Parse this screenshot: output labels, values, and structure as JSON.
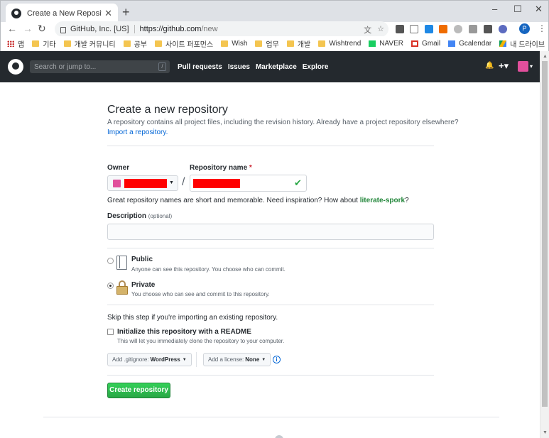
{
  "browser": {
    "tab_title": "Create a New Repository",
    "tab_close": "✕",
    "new_tab": "+",
    "window_controls": [
      "–",
      "☐",
      "✕"
    ],
    "nav": {
      "back": "←",
      "forward": "→",
      "reload": "↻"
    },
    "site_identity": "GitHub, Inc. [US]",
    "url_host": "https://github.com",
    "url_path": "/new",
    "omnibox_icons": [
      "translate-icon",
      "star-icon"
    ],
    "profile_letter": "P",
    "menu": "⋮"
  },
  "bookmarks": [
    {
      "label": "앱",
      "icon": "apps-icon"
    },
    {
      "label": "기타",
      "icon": "folder-icon"
    },
    {
      "label": "개발 커뮤니티",
      "icon": "folder-icon"
    },
    {
      "label": "공부",
      "icon": "folder-icon"
    },
    {
      "label": "사이트 퍼포먼스",
      "icon": "folder-icon"
    },
    {
      "label": "Wish",
      "icon": "folder-icon"
    },
    {
      "label": "업무",
      "icon": "folder-icon"
    },
    {
      "label": "개발",
      "icon": "folder-icon"
    },
    {
      "label": "Wishtrend",
      "icon": "folder-icon"
    },
    {
      "label": "NAVER",
      "icon": "naver-icon"
    },
    {
      "label": "Gmail",
      "icon": "gmail-icon"
    },
    {
      "label": "Gcalendar",
      "icon": "calendar-icon"
    },
    {
      "label": "내 드라이브",
      "icon": "drive-icon"
    }
  ],
  "github_header": {
    "search_placeholder": "Search or jump to...",
    "search_shortcut": "/",
    "nav": [
      "Pull requests",
      "Issues",
      "Marketplace",
      "Explore"
    ],
    "bell": "🔔",
    "plus": "+▾",
    "avatar_caret": "▾"
  },
  "page": {
    "title": "Create a new repository",
    "subtitle": "A repository contains all project files, including the revision history. Already have a project repository elsewhere?",
    "import_link": "Import a repository.",
    "owner_label": "Owner",
    "repo_name_label": "Repository name",
    "required_mark": "*",
    "separator": "/",
    "check": "✔",
    "hint_prefix": "Great repository names are short and memorable. Need inspiration? How about",
    "hint_suggestion": "literate-spork",
    "hint_suffix": "?",
    "description_label": "Description",
    "description_optional": "(optional)",
    "public_title": "Public",
    "public_desc": "Anyone can see this repository. You choose who can commit.",
    "private_title": "Private",
    "private_desc": "You choose who can see and commit to this repository.",
    "visibility_selected": "Private",
    "skip_text": "Skip this step if you're importing an existing repository.",
    "init_title": "Initialize this repository with a README",
    "init_desc": "This will let you immediately clone the repository to your computer.",
    "init_checked": false,
    "gitignore_prefix": "Add .gitignore:",
    "gitignore_value": "WordPress",
    "license_prefix": "Add a license:",
    "license_value": "None",
    "info": "i",
    "create_button": "Create repository"
  },
  "colors": {
    "header_bg": "#24292e",
    "create_green": "#28a745",
    "link_blue": "#0366d6",
    "redaction": "#ff0000",
    "avatar_pink": "#e14f9c"
  }
}
